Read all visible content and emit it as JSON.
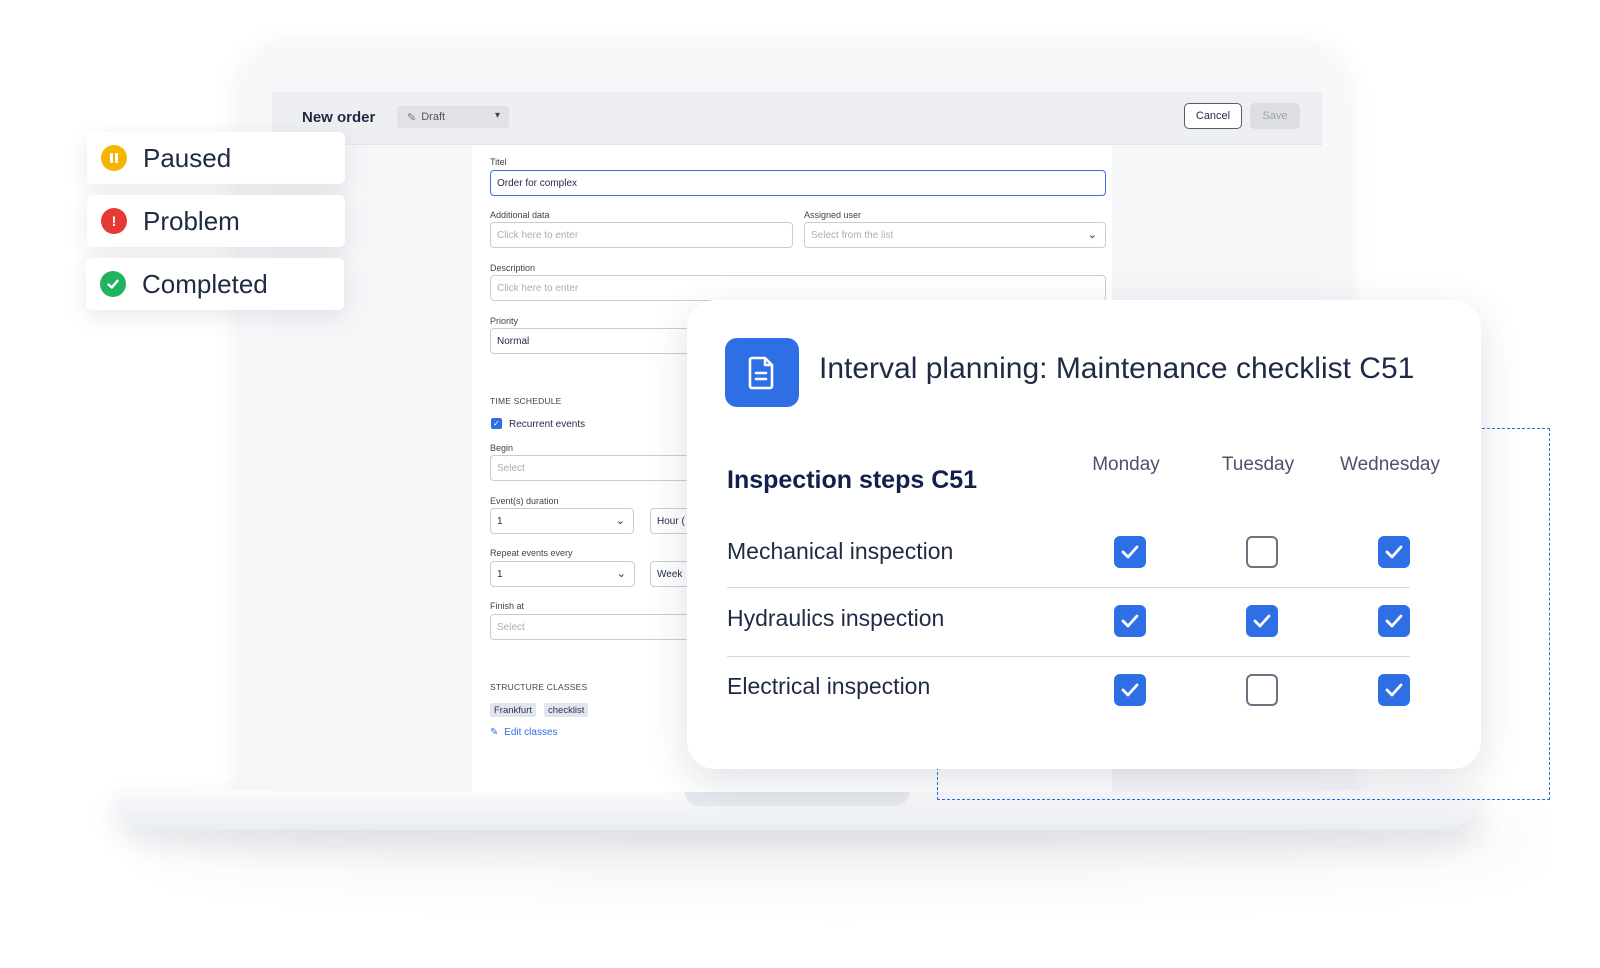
{
  "status_cards": [
    {
      "label": "Paused",
      "color": "#f4b400",
      "icon": "pause-icon"
    },
    {
      "label": "Problem",
      "color": "#e53935",
      "icon": "exclamation-icon"
    },
    {
      "label": "Completed",
      "color": "#22b35e",
      "icon": "check-circle-icon"
    }
  ],
  "order_form": {
    "title": "New order",
    "status_value": "Draft",
    "cancel_label": "Cancel",
    "save_label": "Save",
    "titel_label": "Titel",
    "titel_value": "Order for complex",
    "additional_data_label": "Additional data",
    "additional_data_placeholder": "Click here to enter",
    "assigned_user_label": "Assigned user",
    "assigned_user_placeholder": "Select from the list",
    "description_label": "Description",
    "description_placeholder": "Click here to enter",
    "priority_label": "Priority",
    "priority_value": "Normal",
    "time_schedule_heading": "TIME SCHEDULE",
    "recurrent_events_label": "Recurrent events",
    "recurrent_events_checked": true,
    "begin_label": "Begin",
    "begin_placeholder": "Select",
    "duration_label": "Event(s) duration",
    "duration_value": "1",
    "duration_unit": "Hour (",
    "repeat_label": "Repeat events every",
    "repeat_value": "1",
    "repeat_unit": "Week",
    "finish_label": "Finish at",
    "finish_placeholder": "Select",
    "structure_classes_heading": "STRUCTURE CLASSES",
    "classes": [
      "Frankfurt",
      "checklist"
    ],
    "edit_classes_label": "Edit classes"
  },
  "interval_card": {
    "title": "Interval planning: Maintenance checklist C51",
    "steps_heading": "Inspection steps C51",
    "days": [
      "Monday",
      "Tuesday",
      "Wednesday"
    ],
    "rows": [
      {
        "label": "Mechanical inspection",
        "checks": [
          true,
          false,
          true
        ]
      },
      {
        "label": "Hydraulics inspection",
        "checks": [
          true,
          true,
          true
        ]
      },
      {
        "label": "Electrical inspection",
        "checks": [
          true,
          false,
          true
        ]
      }
    ]
  },
  "colors": {
    "accent": "#2f6fe6",
    "text": "#1f2a44"
  }
}
